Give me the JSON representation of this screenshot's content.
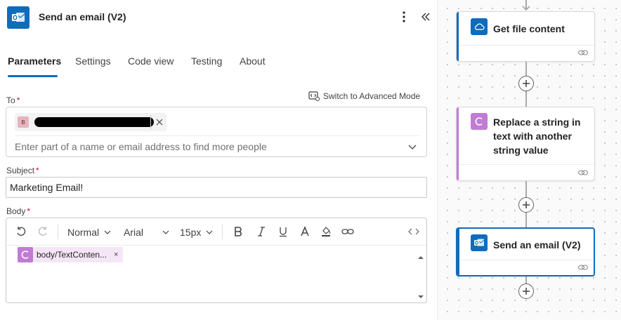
{
  "panel": {
    "title": "Send an email (V2)"
  },
  "tabs": [
    {
      "label": "Parameters"
    },
    {
      "label": "Settings"
    },
    {
      "label": "Code view"
    },
    {
      "label": "Testing"
    },
    {
      "label": "About"
    }
  ],
  "fields": {
    "to": {
      "label": "To",
      "required_mark": "*",
      "chip_initial": "B",
      "placeholder": "Enter part of a name or email address to find more people"
    },
    "advanced_mode": "Switch to Advanced Mode",
    "subject": {
      "label": "Subject",
      "required_mark": "*",
      "value": "Marketing Email!"
    },
    "body": {
      "label": "Body",
      "required_mark": "*",
      "paragraph_style": "Normal",
      "font": "Arial",
      "font_size": "15px",
      "token_text": "body/TextConten...",
      "token_remove": "×"
    }
  },
  "flow": {
    "cards": [
      {
        "title": "Get file content",
        "icon": "onedrive-cloud-icon",
        "accent": "#0f6cbd"
      },
      {
        "title": "Replace a string in text with another string value",
        "icon": "text-function-icon",
        "accent": "#c17bd4"
      },
      {
        "title": "Send an email (V2)",
        "icon": "outlook-icon",
        "accent": "#0f6cbd"
      }
    ]
  },
  "colors": {
    "accent": "#0f6cbd",
    "required": "#c50f1f",
    "token_purple": "#c17bd4"
  }
}
